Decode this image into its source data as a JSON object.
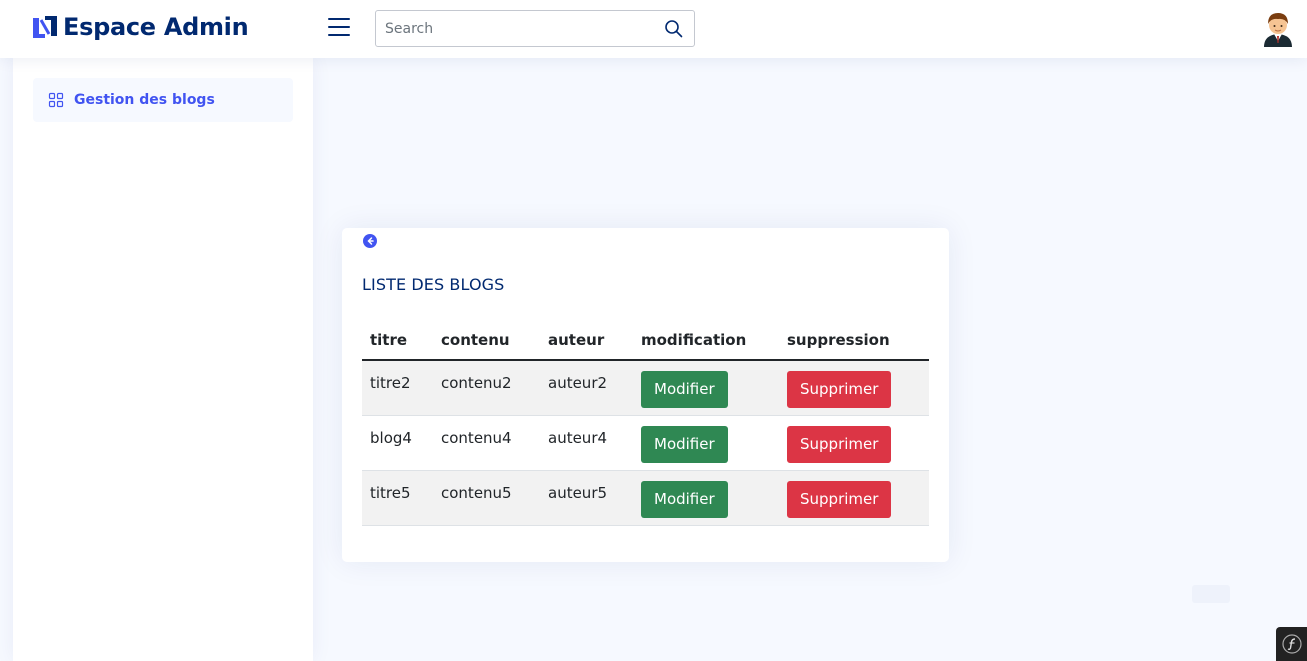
{
  "header": {
    "title": "Espace Admin",
    "search_placeholder": "Search"
  },
  "sidebar": {
    "items": [
      {
        "label": "Gestion des blogs",
        "icon": "grid-icon"
      }
    ]
  },
  "card": {
    "title": "LISTE DES BLOGS",
    "columns": [
      "titre",
      "contenu",
      "auteur",
      "modification",
      "suppression"
    ],
    "rows": [
      {
        "titre": "titre2",
        "contenu": "contenu2",
        "auteur": "auteur2",
        "modifier": "Modifier",
        "supprimer": "Supprimer"
      },
      {
        "titre": "blog4",
        "contenu": "contenu4",
        "auteur": "auteur4",
        "modifier": "Modifier",
        "supprimer": "Supprimer"
      },
      {
        "titre": "titre5",
        "contenu": "contenu5",
        "auteur": "auteur5",
        "modifier": "Modifier",
        "supprimer": "Supprimer"
      }
    ]
  },
  "colors": {
    "brand": "#012970",
    "accent": "#4154f1",
    "success": "#2f8853",
    "danger": "#dc3545"
  }
}
